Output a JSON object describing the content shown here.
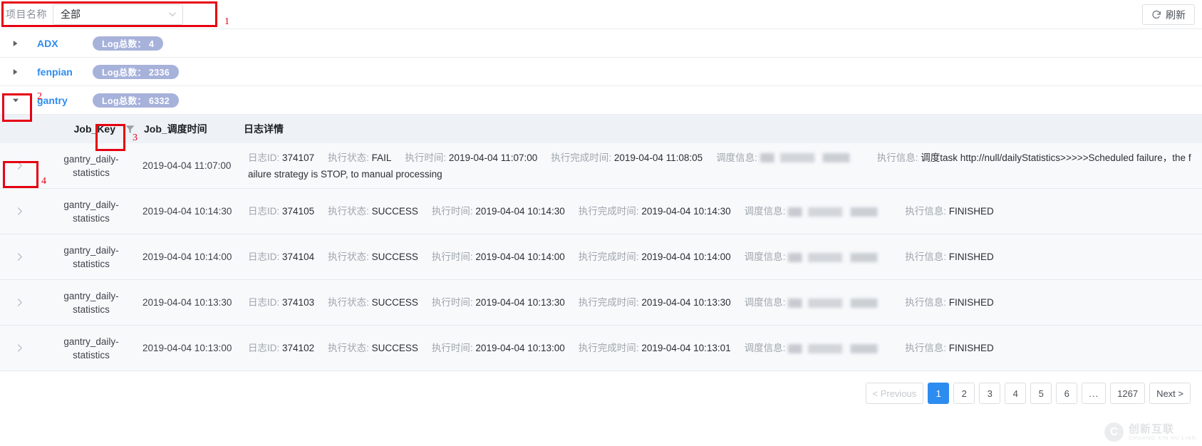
{
  "filter_bar": {
    "label": "项目名称",
    "select_value": "全部",
    "select_placeholder": "全部",
    "caret_icon": "chevron-down-icon",
    "refresh_label": "刷新",
    "refresh_icon": "refresh-icon",
    "annotation_1": "1"
  },
  "annotations": {
    "a1": "1",
    "a2": "2",
    "a3": "3",
    "a4": "4",
    "color": "#e60012"
  },
  "projects": [
    {
      "name": "ADX",
      "badge": "Log总数： 4",
      "expanded": false,
      "arrow_icon": "triangle-right-icon"
    },
    {
      "name": "fenpian",
      "badge": "Log总数： 2336",
      "expanded": false,
      "arrow_icon": "triangle-right-icon"
    },
    {
      "name": "gantry",
      "badge": "Log总数： 6332",
      "expanded": true,
      "arrow_icon": "triangle-down-icon"
    }
  ],
  "table": {
    "headers": {
      "job_key": "Job_Key",
      "filter_icon": "filter-icon",
      "schedule_time": "Job_调度时间",
      "log_detail": "日志详情"
    },
    "labels": {
      "log_id": "日志ID:",
      "exec_status": "执行状态:",
      "exec_time": "执行时间:",
      "finish_time": "执行完成时间:",
      "sched_info": "调度信息:",
      "exec_info": "执行信息:"
    },
    "expand_icon": "chevron-right-icon",
    "rows": [
      {
        "job_key": "gantry_daily-statistics",
        "schedule_time": "2019-04-04 11:07:00",
        "log_id": "374107",
        "exec_status": "FAIL",
        "exec_time": "2019-04-04 11:07:00",
        "finish_time": "2019-04-04 11:08:05",
        "sched_info": "",
        "exec_info": "调度task http://null/dailyStatistics>>>>>Scheduled failure，the f",
        "exec_info_line2": "ailure strategy is STOP, to manual processing",
        "selected": true
      },
      {
        "job_key": "gantry_daily-statistics",
        "schedule_time": "2019-04-04 10:14:30",
        "log_id": "374105",
        "exec_status": "SUCCESS",
        "exec_time": "2019-04-04 10:14:30",
        "finish_time": "2019-04-04 10:14:30",
        "sched_info": "",
        "exec_info": "FINISHED",
        "exec_info_line2": "",
        "selected": false
      },
      {
        "job_key": "gantry_daily-statistics",
        "schedule_time": "2019-04-04 10:14:00",
        "log_id": "374104",
        "exec_status": "SUCCESS",
        "exec_time": "2019-04-04 10:14:00",
        "finish_time": "2019-04-04 10:14:00",
        "sched_info": "",
        "exec_info": "FINISHED",
        "exec_info_line2": "",
        "selected": false
      },
      {
        "job_key": "gantry_daily-statistics",
        "schedule_time": "2019-04-04 10:13:30",
        "log_id": "374103",
        "exec_status": "SUCCESS",
        "exec_time": "2019-04-04 10:13:30",
        "finish_time": "2019-04-04 10:13:30",
        "sched_info": "",
        "exec_info": "FINISHED",
        "exec_info_line2": "",
        "selected": false
      },
      {
        "job_key": "gantry_daily-statistics",
        "schedule_time": "2019-04-04 10:13:00",
        "log_id": "374102",
        "exec_status": "SUCCESS",
        "exec_time": "2019-04-04 10:13:00",
        "finish_time": "2019-04-04 10:13:01",
        "sched_info": "",
        "exec_info": "FINISHED",
        "exec_info_line2": "",
        "selected": false
      }
    ]
  },
  "pagination": {
    "prev": "< Previous",
    "next": "Next >",
    "pages": [
      "1",
      "2",
      "3",
      "4",
      "5",
      "6"
    ],
    "ellipsis": "...",
    "last": "1267",
    "current": "1"
  },
  "watermark": {
    "mark": "C",
    "cn": "创新互联",
    "en": "CHUANG XIN HU LIAN"
  },
  "colors": {
    "accent": "#2d8cf0",
    "badge": "#a7b2db",
    "annotation": "#e60012",
    "header_bg": "#eef1f6",
    "row_bg": "#f7f9fb"
  }
}
